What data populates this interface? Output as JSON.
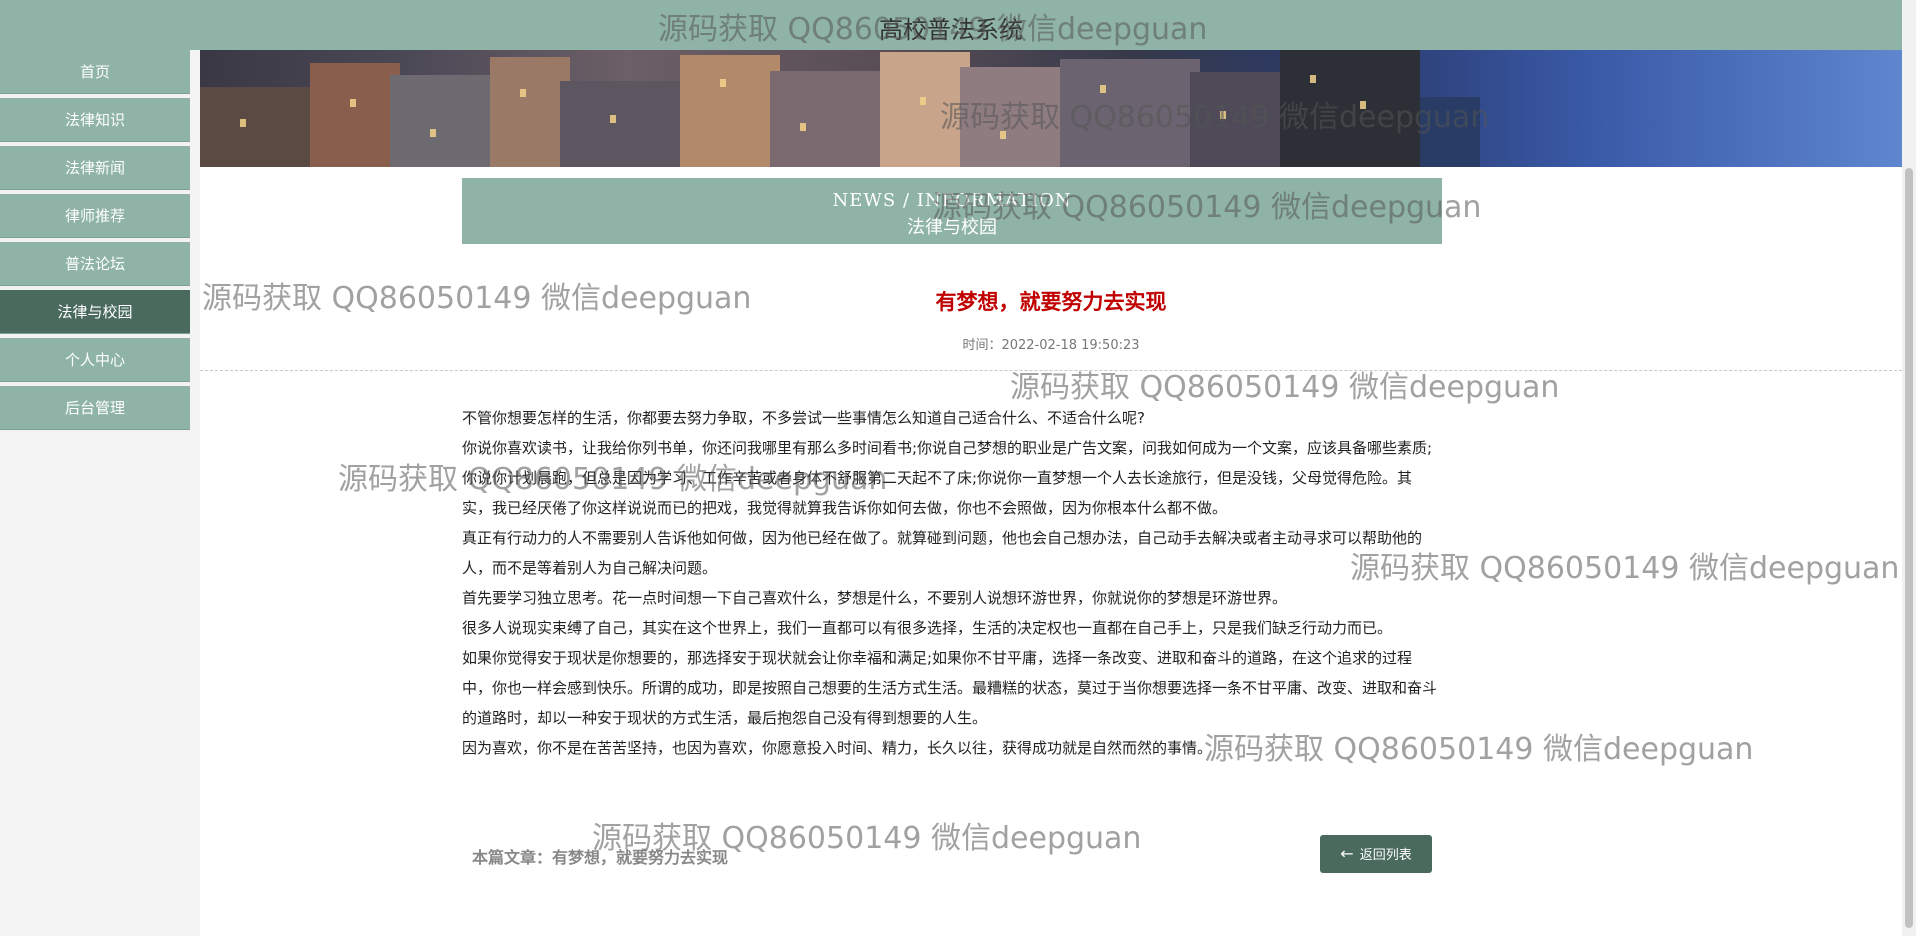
{
  "app": {
    "title": "高校普法系统"
  },
  "sidebar": {
    "items": [
      {
        "label": "首页"
      },
      {
        "label": "法律知识"
      },
      {
        "label": "法律新闻"
      },
      {
        "label": "律师推荐"
      },
      {
        "label": "普法论坛"
      },
      {
        "label": "法律与校园",
        "active": true
      },
      {
        "label": "个人中心"
      },
      {
        "label": "后台管理"
      }
    ]
  },
  "section": {
    "en_label": "NEWS / INFORMATION",
    "cn_label": "法律与校园"
  },
  "article": {
    "title": "有梦想，就要努力去实现",
    "time": "时间：2022-02-18 19:50:23",
    "paragraphs": [
      "不管你想要怎样的生活，你都要去努力争取，不多尝试一些事情怎么知道自己适合什么、不适合什么呢?",
      "你说你喜欢读书，让我给你列书单，你还问我哪里有那么多时间看书;你说自己梦想的职业是广告文案，问我如何成为一个文案，应该具备哪些素质;你说你计划晨跑，但总是因为学习、工作辛苦或者身体不舒服第二天起不了床;你说你一直梦想一个人去长途旅行，但是没钱，父母觉得危险。其实，我已经厌倦了你这样说说而已的把戏，我觉得就算我告诉你如何去做，你也不会照做，因为你根本什么都不做。",
      "真正有行动力的人不需要别人告诉他如何做，因为他已经在做了。就算碰到问题，他也会自己想办法，自己动手去解决或者主动寻求可以帮助他的人，而不是等着别人为自己解决问题。",
      "首先要学习独立思考。花一点时间想一下自己喜欢什么，梦想是什么，不要别人说想环游世界，你就说你的梦想是环游世界。",
      "很多人说现实束缚了自己，其实在这个世界上，我们一直都可以有很多选择，生活的决定权也一直都在自己手上，只是我们缺乏行动力而已。",
      "如果你觉得安于现状是你想要的，那选择安于现状就会让你幸福和满足;如果你不甘平庸，选择一条改变、进取和奋斗的道路，在这个追求的过程中，你也一样会感到快乐。所谓的成功，即是按照自己想要的生活方式生活。最糟糕的状态，莫过于当你想要选择一条不甘平庸、改变、进取和奋斗的道路时，却以一种安于现状的方式生活，最后抱怨自己没有得到想要的人生。",
      "因为喜欢，你不是在苦苦坚持，也因为喜欢，你愿意投入时间、精力，长久以往，获得成功就是自然而然的事情。"
    ],
    "footer_ref": "本篇文章：有梦想，就要努力去实现"
  },
  "actions": {
    "back_label": "返回列表"
  },
  "watermark": {
    "text": "源码获取 QQ86050149 微信deepguan"
  },
  "colors": {
    "primary": "#8fb3a6",
    "dark": "#4a6a5e",
    "title_red": "#c00000"
  }
}
